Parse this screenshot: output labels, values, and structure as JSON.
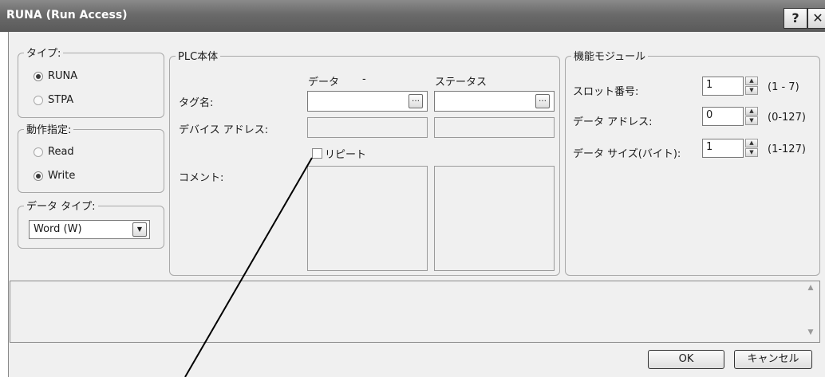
{
  "window": {
    "title": "RUNA (Run Access)",
    "help_glyph": "?",
    "close_glyph": "✕"
  },
  "type_group": {
    "legend": "タイプ:",
    "options": [
      {
        "label": "RUNA",
        "selected": true
      },
      {
        "label": "STPA",
        "selected": false
      }
    ]
  },
  "action_group": {
    "legend": "動作指定:",
    "options": [
      {
        "label": "Read",
        "selected": false
      },
      {
        "label": "Write",
        "selected": true
      }
    ]
  },
  "datatype_group": {
    "legend": "データ タイプ:",
    "value": "Word (W)",
    "arrow": "▼"
  },
  "plc_group": {
    "legend": "PLC本体",
    "col_data": "データ",
    "col_dash": "-",
    "col_status": "ステータス",
    "tag_label": "タグ名:",
    "device_label": "デバイス アドレス:",
    "repeat_label": "リピート",
    "comment_label": "コメント:",
    "browse_glyph": "…",
    "tag_data_value": "",
    "tag_status_value": ""
  },
  "module_group": {
    "legend": "機能モジュール",
    "rows": [
      {
        "label": "スロット番号:",
        "value": "1",
        "range": "(1 - 7)"
      },
      {
        "label": "データ アドレス:",
        "value": "0",
        "range": "(0-127)"
      },
      {
        "label": "データ サイズ(バイト):",
        "value": "1",
        "range": "(1-127)"
      }
    ]
  },
  "scroll": {
    "up": "▲",
    "down": "▼"
  },
  "buttons": {
    "ok": "OK",
    "cancel": "キャンセル"
  }
}
